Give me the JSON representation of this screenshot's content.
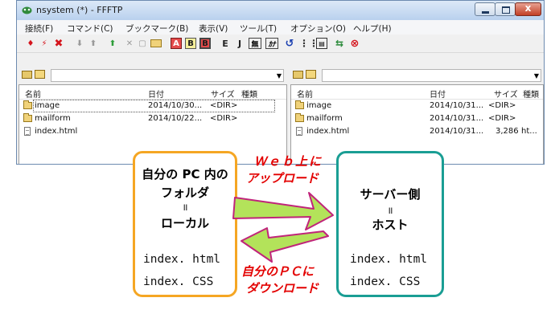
{
  "window": {
    "title": "nsystem (*) - FFFTP",
    "close_glyph": "x"
  },
  "menu": [
    "接続(F)",
    "コマンド(C)",
    "ブックマーク(B)",
    "表示(V)",
    "ツール(T)",
    "オプション(O)",
    "ヘルプ(H)"
  ],
  "toolbar": {
    "icons": [
      "connect-icon",
      "quick-connect-icon",
      "disconnect-icon",
      "download-icon",
      "upload-icon",
      "mirror-upload-icon",
      "delete-icon",
      "rename-icon",
      "mkdir-icon",
      "ascii-mode-icon",
      "binary-mode-icon",
      "auto-mode-icon",
      "euc-icon",
      "jis-icon",
      "no-convert-icon",
      "kana-icon",
      "refresh-icon",
      "list-view-icon",
      "detail-view-icon",
      "sync-icon",
      "stop-icon"
    ],
    "labels": {
      "b1": "B",
      "b2": "B",
      "e": "E",
      "j": "J",
      "no": "無",
      "kana": "ｶﾅ"
    }
  },
  "columns": {
    "name": "名前",
    "date": "日付",
    "size": "サイズ",
    "kind": "種類"
  },
  "left_pane": {
    "files": [
      {
        "name": "image",
        "date": "2014/10/30...",
        "size": "<DIR>",
        "kind": "",
        "type": "folder"
      },
      {
        "name": "mailform",
        "date": "2014/10/22...",
        "size": "<DIR>",
        "kind": "",
        "type": "folder"
      },
      {
        "name": "index.html",
        "date": "",
        "size": "",
        "kind": "",
        "type": "file"
      }
    ]
  },
  "right_pane": {
    "files": [
      {
        "name": "image",
        "date": "2014/10/31...",
        "size": "<DIR>",
        "kind": "",
        "type": "folder"
      },
      {
        "name": "mailform",
        "date": "2014/10/31...",
        "size": "<DIR>",
        "kind": "",
        "type": "folder"
      },
      {
        "name": "index.html",
        "date": "2014/10/31...",
        "size": "3,286",
        "kind": "ht...",
        "type": "file"
      }
    ]
  },
  "diagram": {
    "local": {
      "line1": "自分の PC 内の",
      "line2": "フォルダ",
      "eq": "॥",
      "line3": "ローカル",
      "file1": "index. html",
      "file2": "index. CSS",
      "color": "#f5a623"
    },
    "host": {
      "line1": "サーバー側",
      "eq": "॥",
      "line2": "ホスト",
      "file1": "index. html",
      "file2": "index. CSS",
      "color": "#1a9e94"
    },
    "upload": {
      "line1": "Ｗｅｂ上に",
      "line2": "アップロード"
    },
    "download": {
      "line1": "自分のＰＣに",
      "line2": "ダウンロード"
    },
    "arrow_fill": "#b3e35a",
    "arrow_outline": "#c0247a",
    "label_color": "#e30000"
  }
}
